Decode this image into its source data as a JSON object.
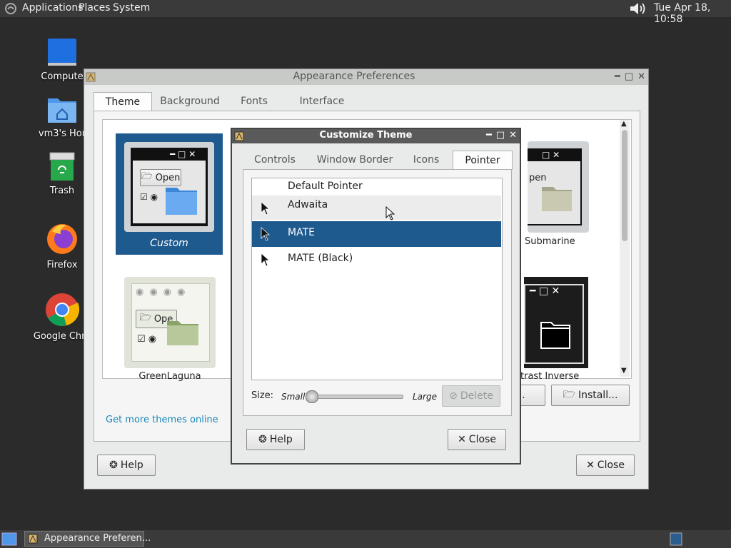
{
  "top_panel": {
    "menus": [
      "Applications",
      "Places",
      "System"
    ],
    "clock": "Tue Apr 18, 10:58"
  },
  "desktop": {
    "icons": [
      {
        "label": "Compute",
        "icon": "computer-icon"
      },
      {
        "label": "vm3's Hor",
        "icon": "home-folder-icon"
      },
      {
        "label": "Trash",
        "icon": "trash-icon"
      },
      {
        "label": "Firefox",
        "icon": "firefox-icon"
      },
      {
        "label": "Google Chro",
        "icon": "chrome-icon"
      }
    ]
  },
  "appearance": {
    "title": "Appearance Preferences",
    "tabs": [
      "Theme",
      "Background",
      "Fonts",
      "Interface"
    ],
    "active_tab": "Theme",
    "themes": [
      {
        "name": "Custom",
        "selected": true
      },
      {
        "name": "Submarine",
        "selected": false
      },
      {
        "name": "GreenLaguna",
        "selected": false
      },
      {
        "name": "trast Inverse",
        "selected": false
      }
    ],
    "thumb_open_label": "Open",
    "thumb_open_label_partial": "pen",
    "thumb_open_label_green": "Ope",
    "get_more_link": "Get more themes online",
    "customize_partial": "ze...",
    "install_label": "Install...",
    "help_label": "Help",
    "close_label": "Close"
  },
  "customize": {
    "title": "Customize Theme",
    "tabs": [
      "Controls",
      "Window Border",
      "Icons",
      "Pointer"
    ],
    "active_tab": "Pointer",
    "pointers": [
      {
        "label": "Default Pointer",
        "cursor": false,
        "selected": false
      },
      {
        "label": "Adwaita",
        "cursor": true,
        "selected": false
      },
      {
        "label": "MATE",
        "cursor": true,
        "selected": true
      },
      {
        "label": "MATE (Black)",
        "cursor": true,
        "selected": false
      }
    ],
    "size_label": "Size:",
    "small_label": "Small",
    "large_label": "Large",
    "size_value": 0,
    "delete_label": "Delete",
    "help_label": "Help",
    "close_label": "Close"
  },
  "taskbar": {
    "task_label": "Appearance Preferen..."
  },
  "colors": {
    "selection": "#1f5a8f",
    "link": "#1a86b8",
    "panel": "#3a3a3a"
  }
}
